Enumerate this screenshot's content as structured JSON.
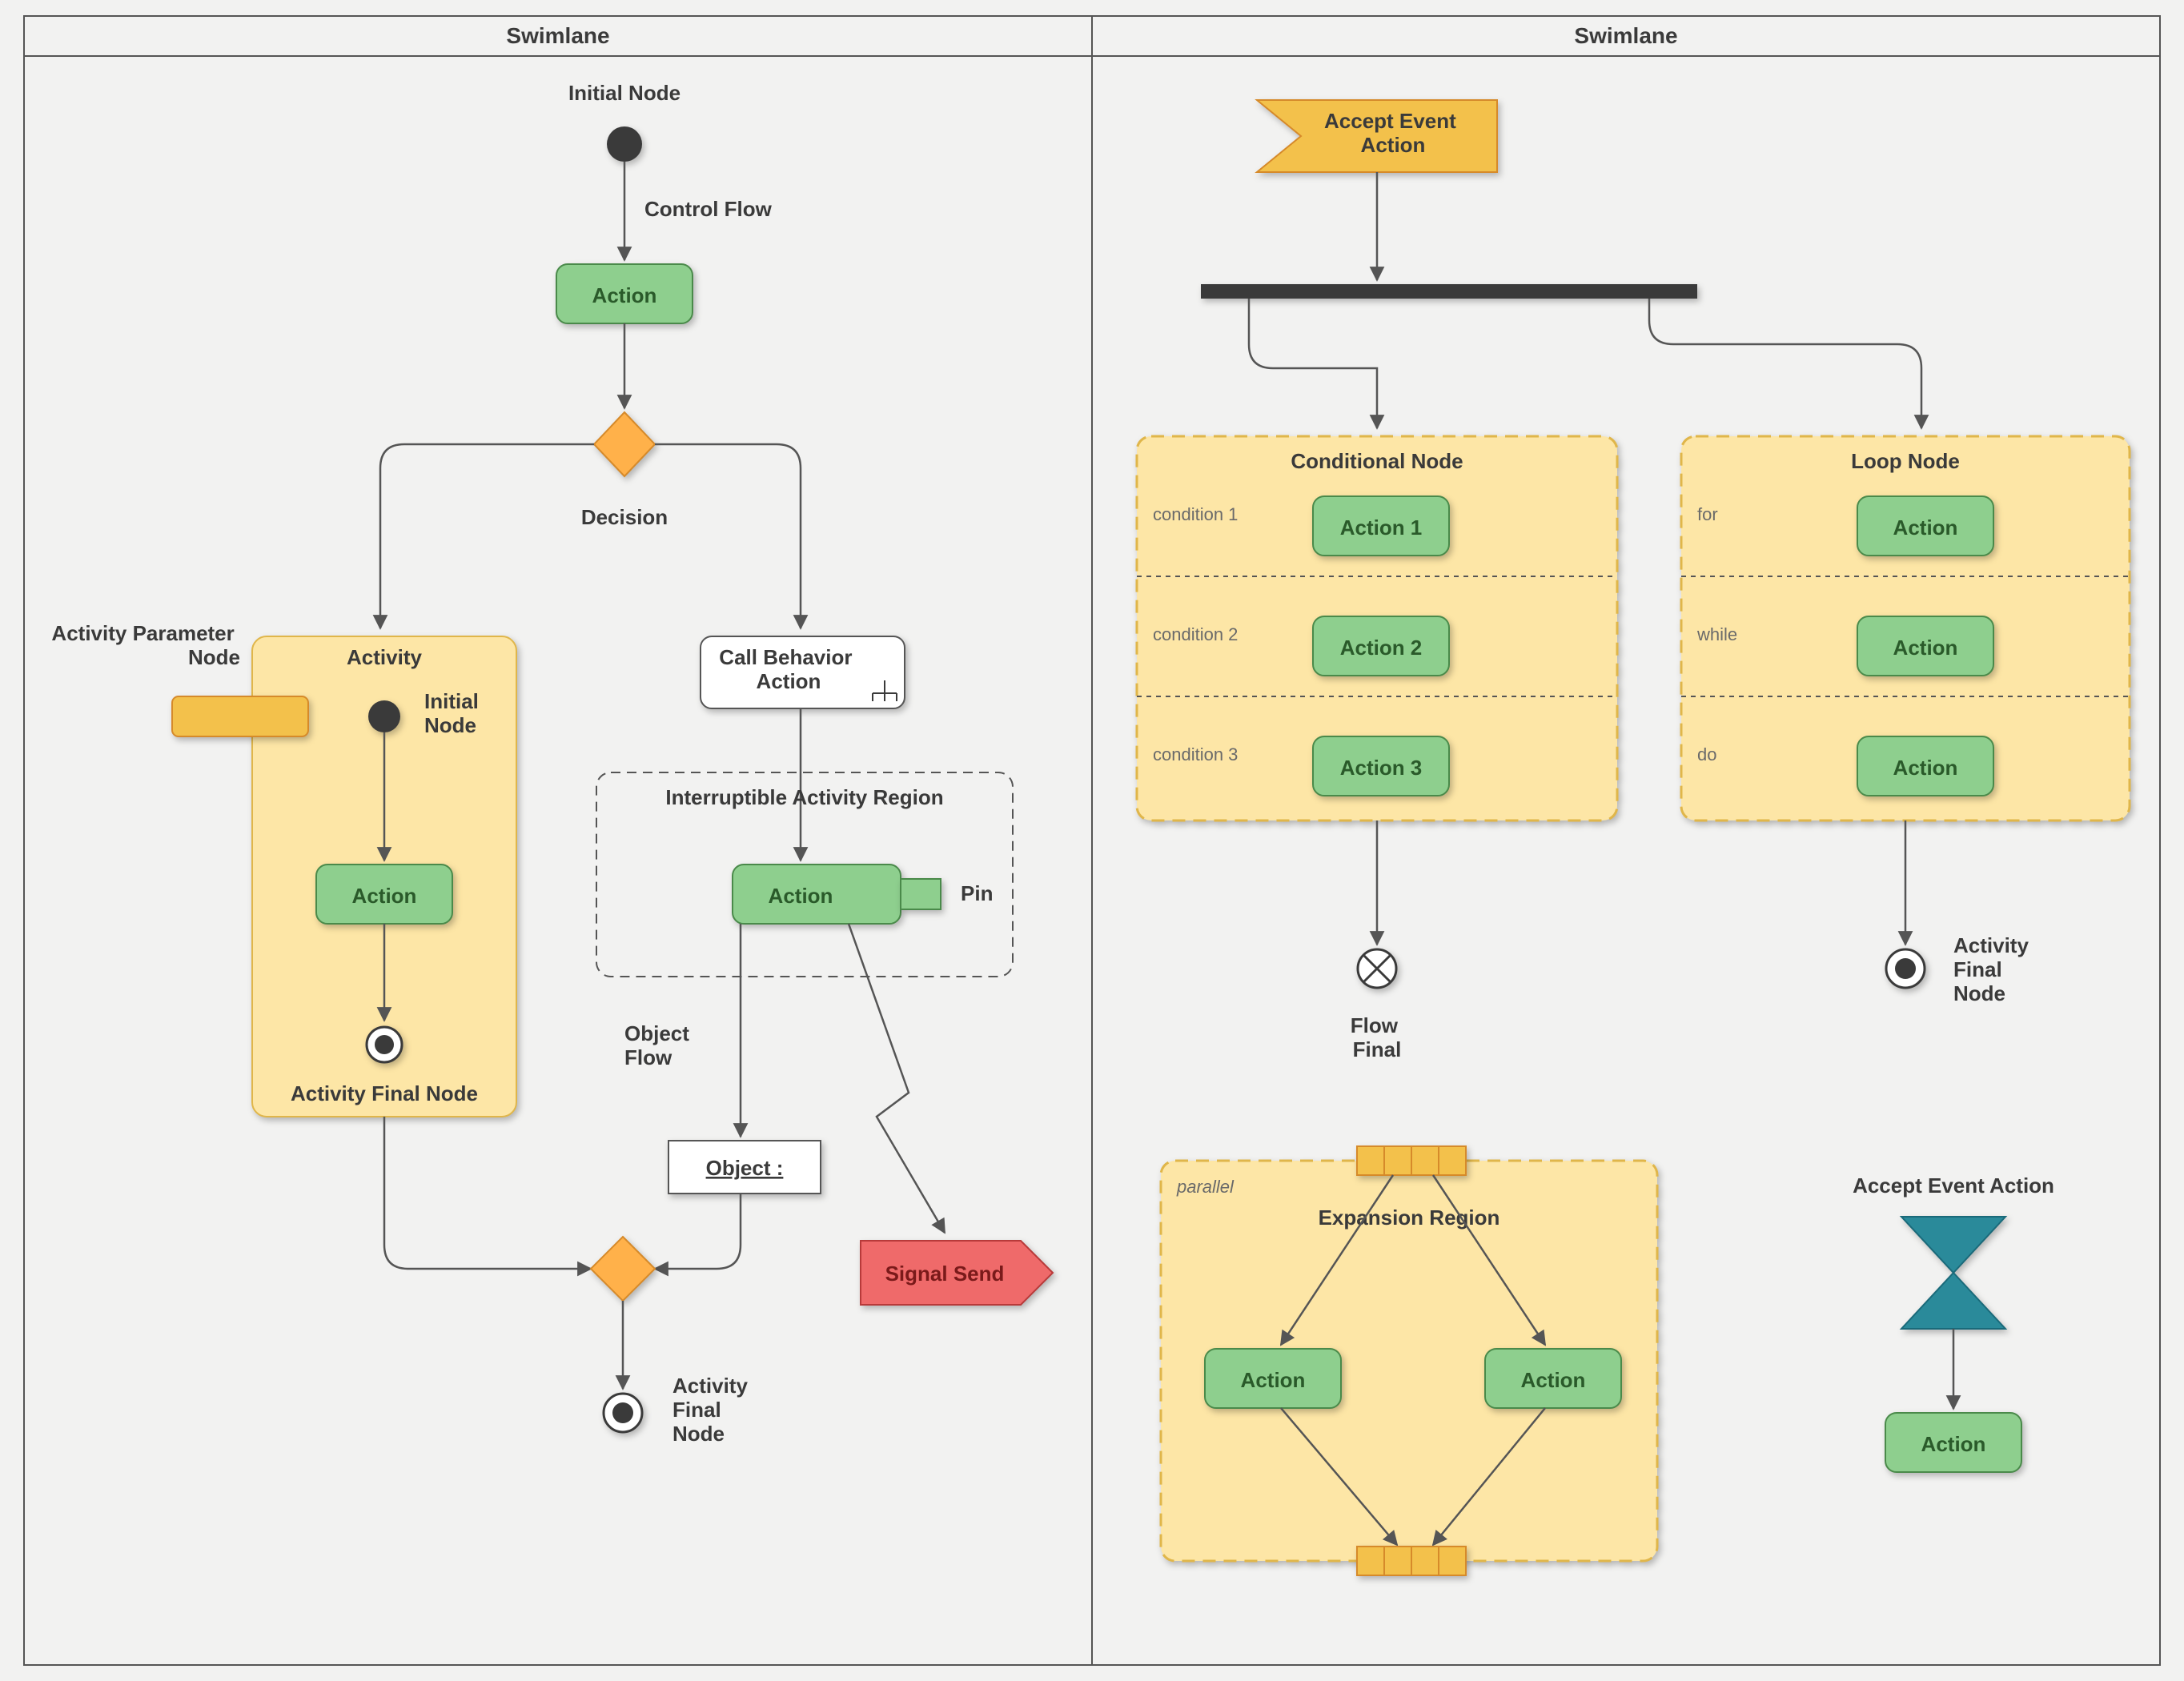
{
  "swimlanes": {
    "left": "Swimlane",
    "right": "Swimlane"
  },
  "left": {
    "initial_node": "Initial Node",
    "control_flow": "Control Flow",
    "action": "Action",
    "decision": "Decision",
    "activity_param": "Activity Parameter\nNode",
    "activity": {
      "title": "Activity",
      "initial": "Initial\nNode",
      "action": "Action",
      "final": "Activity Final Node"
    },
    "call_behavior": "Call Behavior\nAction",
    "interrupt": {
      "title": "Interruptible Activity Region",
      "action": "Action",
      "pin": "Pin"
    },
    "object_flow": "Object\nFlow",
    "object": "Object :",
    "signal_send": "Signal Send",
    "activity_final": "Activity\nFinal\nNode"
  },
  "right": {
    "accept_event": "Accept Event\nAction",
    "conditional": {
      "title": "Conditional Node",
      "rows": [
        {
          "cond": "condition 1",
          "action": "Action 1"
        },
        {
          "cond": "condition 2",
          "action": "Action 2"
        },
        {
          "cond": "condition 3",
          "action": "Action 3"
        }
      ]
    },
    "loop": {
      "title": "Loop Node",
      "rows": [
        {
          "cond": "for",
          "action": "Action"
        },
        {
          "cond": "while",
          "action": "Action"
        },
        {
          "cond": "do",
          "action": "Action"
        }
      ]
    },
    "flow_final": "Flow\nFinal",
    "activity_final": "Activity\nFinal\nNode",
    "expansion": {
      "kind": "parallel",
      "title": "Expansion Region",
      "action_l": "Action",
      "action_r": "Action"
    },
    "accept_event2": {
      "title": "Accept Event Action",
      "action": "Action"
    }
  }
}
